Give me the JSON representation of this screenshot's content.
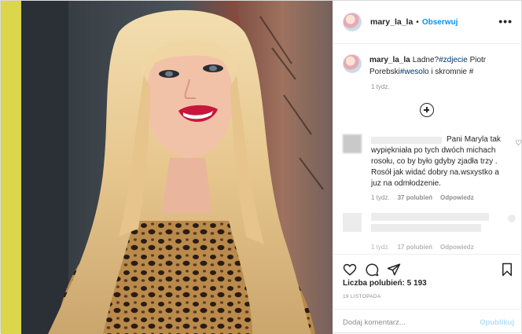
{
  "header": {
    "username": "mary_la_la",
    "separator": "•",
    "follow_label": "Obserwuj",
    "more_icon": "more-icon"
  },
  "caption": {
    "username": "mary_la_la",
    "text_start": "Ladne?",
    "tag1": "#zdjecie",
    "text_mid": " Piotr Porebski",
    "tag2": "#wesolo",
    "text_end": " i skromnie #",
    "time": "1 tydz."
  },
  "comment1": {
    "text": "Pani Maryla tak wypiękniała po tych dwóch michach rosołu, co by było gdyby zjadła trzy . Rosół jak widać dobry na.wsxystko a juz na odmłodzenie.",
    "time": "1 tydz.",
    "likes": "37 polubień",
    "reply": "Odpowiedz"
  },
  "comment2": {
    "time": "1 tydz.",
    "likes": "17 polubień",
    "reply": "Odpowiedz"
  },
  "post": {
    "likes_label": "Liczba polubień: 5 193",
    "date": "19 LISTOPADA"
  },
  "comment_box": {
    "placeholder": "Dodaj komentarz...",
    "publish": "Opublikuj"
  }
}
